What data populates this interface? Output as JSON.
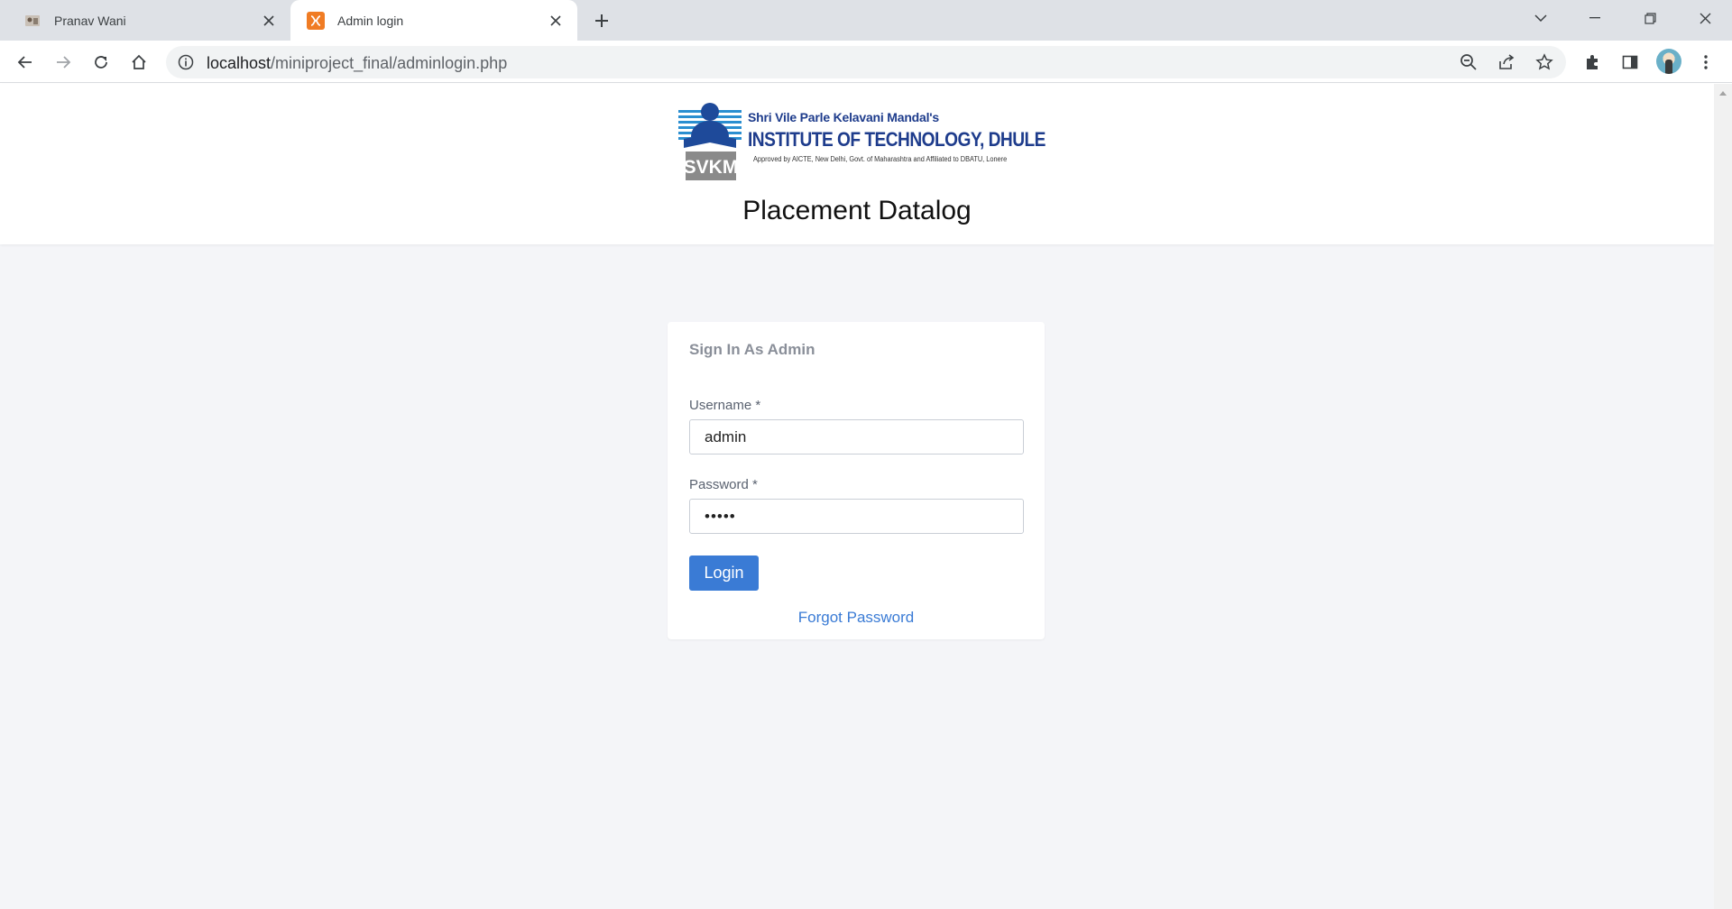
{
  "browser": {
    "tabs": [
      {
        "title": "Pranav Wani",
        "active": false
      },
      {
        "title": "Admin login",
        "active": true
      }
    ],
    "address": {
      "host": "localhost",
      "path": "/miniproject_final/adminlogin.php"
    }
  },
  "header": {
    "logo": {
      "emblem_text": "SVKM",
      "org_name": "Shri Vile Parle Kelavani Mandal's",
      "institute_name": "INSTITUTE OF TECHNOLOGY, DHULE",
      "approval": "Approved by AICTE, New Delhi, Govt. of Maharashtra and Affiliated to DBATU, Lonere"
    },
    "title": "Placement Datalog"
  },
  "login_card": {
    "title": "Sign In As Admin",
    "username": {
      "label": "Username",
      "required_mark": "*",
      "value": "admin"
    },
    "password": {
      "label": "Password",
      "required_mark": "*",
      "value": "•••••"
    },
    "login_label": "Login",
    "forgot_label": "Forgot Password"
  },
  "colors": {
    "accent": "#3a7bd5",
    "page_background": "#f4f5f8",
    "logo_blue": "#1e3c8c"
  }
}
